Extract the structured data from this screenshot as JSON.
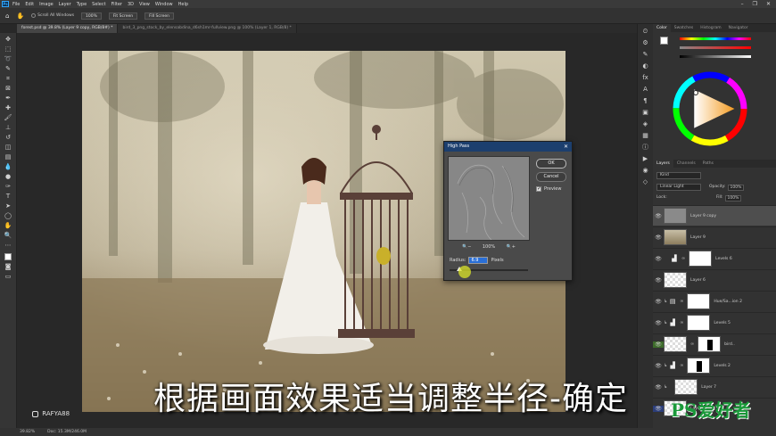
{
  "menubar": {
    "app_icon": "Ps",
    "items": [
      "File",
      "Edit",
      "Image",
      "Layer",
      "Type",
      "Select",
      "Filter",
      "3D",
      "View",
      "Window",
      "Help"
    ]
  },
  "optionsbar": {
    "scroll_all": "Scroll All Windows",
    "zoom": "100%",
    "fit_screen": "Fit Screen",
    "fill_screen": "Fill Screen"
  },
  "tabs": [
    {
      "label": "forest.psd @ 39.8% (Layer 9 copy, RGB/8#) *",
      "active": true
    },
    {
      "label": "bird_3_png_stock_by_elensabdina_d6sh1mr-fullview.png @ 100% (Layer 1, RGB/8) *",
      "active": false
    }
  ],
  "dialog": {
    "title": "High Pass",
    "ok": "OK",
    "cancel": "Cancel",
    "preview": "Preview",
    "preview_checked": true,
    "zoom_out": "−",
    "zoom_level": "100%",
    "zoom_in": "+",
    "radius_label": "Radius:",
    "radius_value": "6.9",
    "radius_unit": "Pixels",
    "radius_slider": 0.12
  },
  "color_panel": {
    "tabs": [
      "Color",
      "Swatches",
      "Histogram",
      "Navigator"
    ]
  },
  "layers_panel": {
    "tabs": [
      "Layers",
      "Channels",
      "Paths"
    ],
    "kind": "Kind",
    "blend_mode": "Linear Light",
    "opacity_label": "Opacity:",
    "opacity": "100%",
    "lock_label": "Lock:",
    "fill_label": "Fill:",
    "fill": "100%",
    "layers": [
      {
        "name": "Layer 9 copy",
        "thumb": "gray",
        "selected": true,
        "mask": false
      },
      {
        "name": "Layer 9",
        "thumb": "photo",
        "selected": false,
        "mask": false
      },
      {
        "name": "Levels 6",
        "thumb": "levels",
        "selected": false,
        "mask": true
      },
      {
        "name": "Layer 6",
        "thumb": "check",
        "selected": false,
        "mask": false
      },
      {
        "name": "Hue/Sa...ion 2",
        "thumb": "hue",
        "selected": false,
        "mask": true
      },
      {
        "name": "Levels 5",
        "thumb": "levels",
        "selected": false,
        "mask": true
      },
      {
        "name": "bird..",
        "thumb": "check",
        "selected": false,
        "mask": true
      },
      {
        "name": "Levels 2",
        "thumb": "levels",
        "selected": false,
        "mask": true
      },
      {
        "name": "Layer 7",
        "thumb": "check",
        "selected": false,
        "mask": false
      },
      {
        "name": "Layer 3",
        "thumb": "check",
        "selected": false,
        "mask": false
      }
    ]
  },
  "status": {
    "zoom": "39.82%",
    "doc": "Doc: 15.3M/246.0M"
  },
  "subtitle": "根据画面效果适当调整半径-确定",
  "watermark": "RAFYA88",
  "site_logo": "PS爱好者",
  "site_url": "www.psahz.com"
}
